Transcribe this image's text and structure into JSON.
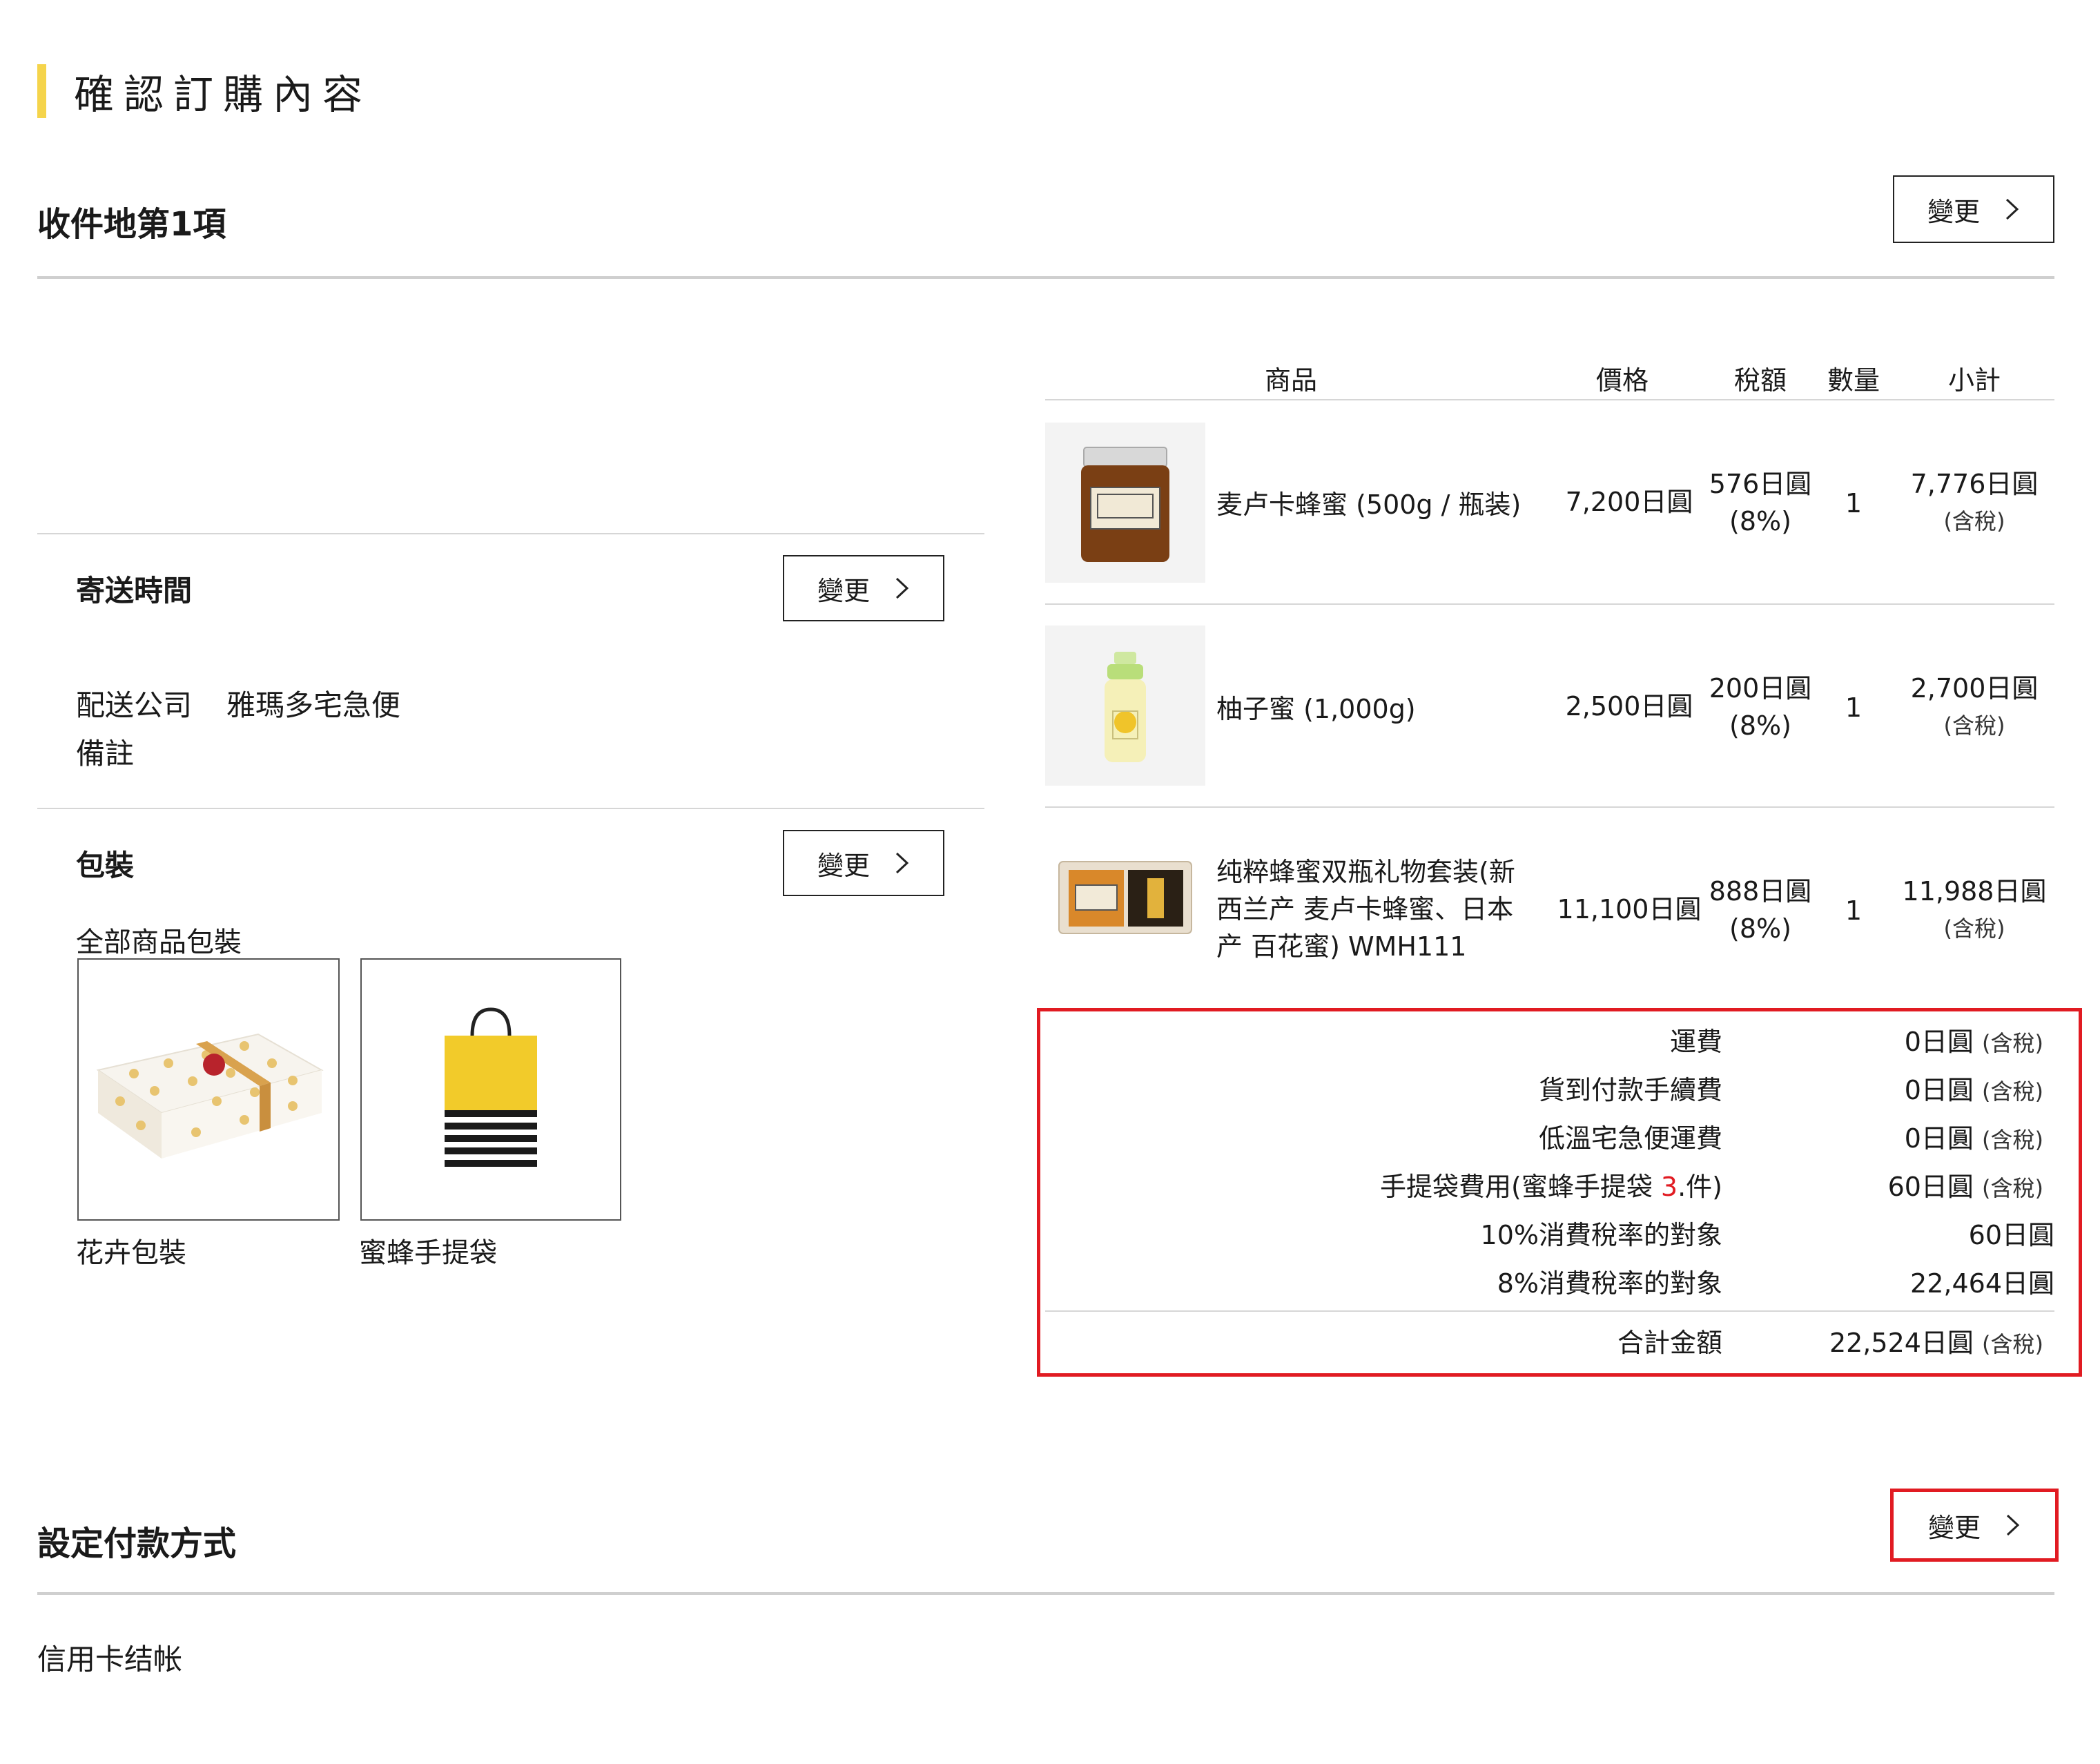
{
  "page_title": "確認訂購內容",
  "destination": {
    "heading": "收件地第1項",
    "change_label": "變更"
  },
  "delivery": {
    "heading": "寄送時間",
    "change_label": "變更",
    "company_label": "配送公司",
    "company_value": "雅瑪多宅急便",
    "remarks_label": "備註"
  },
  "packaging": {
    "heading": "包裝",
    "change_label": "變更",
    "all_label": "全部商品包裝",
    "options": [
      {
        "name": "花卉包裝"
      },
      {
        "name": "蜜蜂手提袋"
      }
    ]
  },
  "table": {
    "headers": {
      "product": "商品",
      "price": "價格",
      "tax": "稅額",
      "qty": "數量",
      "subtotal": "小計"
    },
    "rows": [
      {
        "name": "麦卢卡蜂蜜 (500g / 瓶装)",
        "price": "7,200日圓",
        "tax": "576日圓",
        "tax_rate": "(8%)",
        "qty": "1",
        "subtotal": "7,776日圓",
        "subtotal_note": "(含稅)"
      },
      {
        "name": "柚子蜜 (1,000g)",
        "price": "2,500日圓",
        "tax": "200日圓",
        "tax_rate": "(8%)",
        "qty": "1",
        "subtotal": "2,700日圓",
        "subtotal_note": "(含稅)"
      },
      {
        "name_lines": [
          "纯粹蜂蜜双瓶礼物套装(新",
          "西兰产 麦卢卡蜂蜜、日本",
          "产 百花蜜) WMH111"
        ],
        "price": "11,100日圓",
        "tax": "888日圓",
        "tax_rate": "(8%)",
        "qty": "1",
        "subtotal": "11,988日圓",
        "subtotal_note": "(含稅)"
      }
    ]
  },
  "summary": {
    "shipping": {
      "label": "運費",
      "value": "0日圓",
      "note": "(含稅)"
    },
    "cod_fee": {
      "label": "貨到付款手續費",
      "value": "0日圓",
      "note": "(含稅)"
    },
    "cold_fee": {
      "label": "低溫宅急便運費",
      "value": "0日圓",
      "note": "(含稅)"
    },
    "bag_fee": {
      "label_prefix": "手提袋費用(蜜蜂手提袋 ",
      "label_count": "3",
      "label_suffix": ".件)",
      "value": "60日圓",
      "note": "(含稅)"
    },
    "tax10": {
      "label": "10%消費稅率的對象",
      "value": "60日圓"
    },
    "tax8": {
      "label": "8%消費稅率的對象",
      "value": "22,464日圓"
    },
    "total": {
      "label": "合計金額",
      "value": "22,524日圓",
      "note": "(含稅)"
    }
  },
  "payment": {
    "heading": "設定付款方式",
    "change_label": "變更",
    "method": "信用卡结帐"
  }
}
